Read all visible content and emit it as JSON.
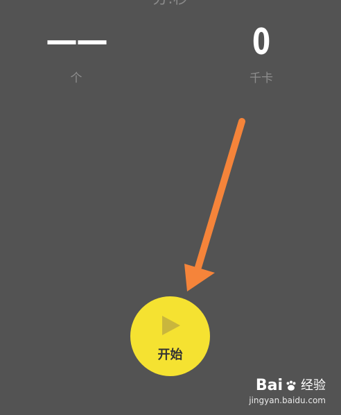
{
  "header": {
    "partial_label": "分:秒"
  },
  "stats": {
    "count_value": "——",
    "count_unit": "个",
    "calorie_value": "0",
    "calorie_unit": "千卡"
  },
  "start_button": {
    "label": "开始",
    "icon": "play-icon"
  },
  "annotation": {
    "icon": "arrow-annotation-icon",
    "color": "#f5843a"
  },
  "watermark": {
    "brand_left": "Bai",
    "brand_right": "经验",
    "url": "jingyan.baidu.com"
  },
  "colors": {
    "background": "#535353",
    "button": "#f5e231"
  }
}
